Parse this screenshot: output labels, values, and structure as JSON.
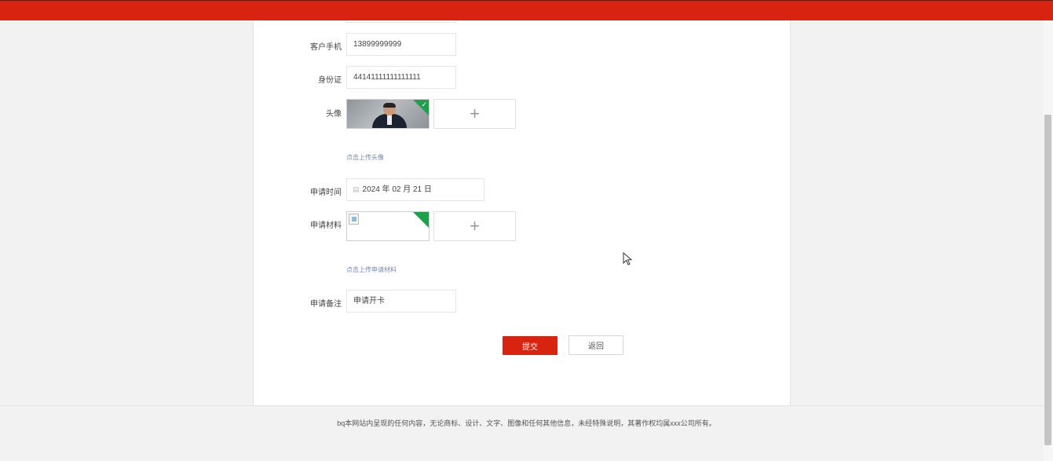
{
  "form": {
    "phone": {
      "label": "客户手机",
      "value": "13899999999"
    },
    "id_card": {
      "label": "身份证",
      "value": "44141111111111111"
    },
    "avatar": {
      "label": "头像",
      "hint": "点击上传头像",
      "plus": "+",
      "check": "✓"
    },
    "apply_date": {
      "label": "申请时间",
      "value": "2024 年 02 月 21 日"
    },
    "materials": {
      "label": "申请材料",
      "hint": "点击上传申请材料",
      "plus": "+"
    },
    "remark": {
      "label": "申请备注",
      "value": "申请开卡"
    }
  },
  "buttons": {
    "submit": "提交",
    "back": "返回"
  },
  "footer": {
    "text": "bq本网站内呈现的任何内容，无论商标、设计、文字、图像和任何其他信息，未经特殊说明，其著作权均属xxx公司所有。"
  },
  "colors": {
    "brand": "#d7230f",
    "upload_ok": "#1aa34a"
  },
  "icons": {
    "calendar": "calendar-icon",
    "plus": "plus-icon",
    "check": "check-icon",
    "cursor": "mouse-pointer-icon"
  }
}
